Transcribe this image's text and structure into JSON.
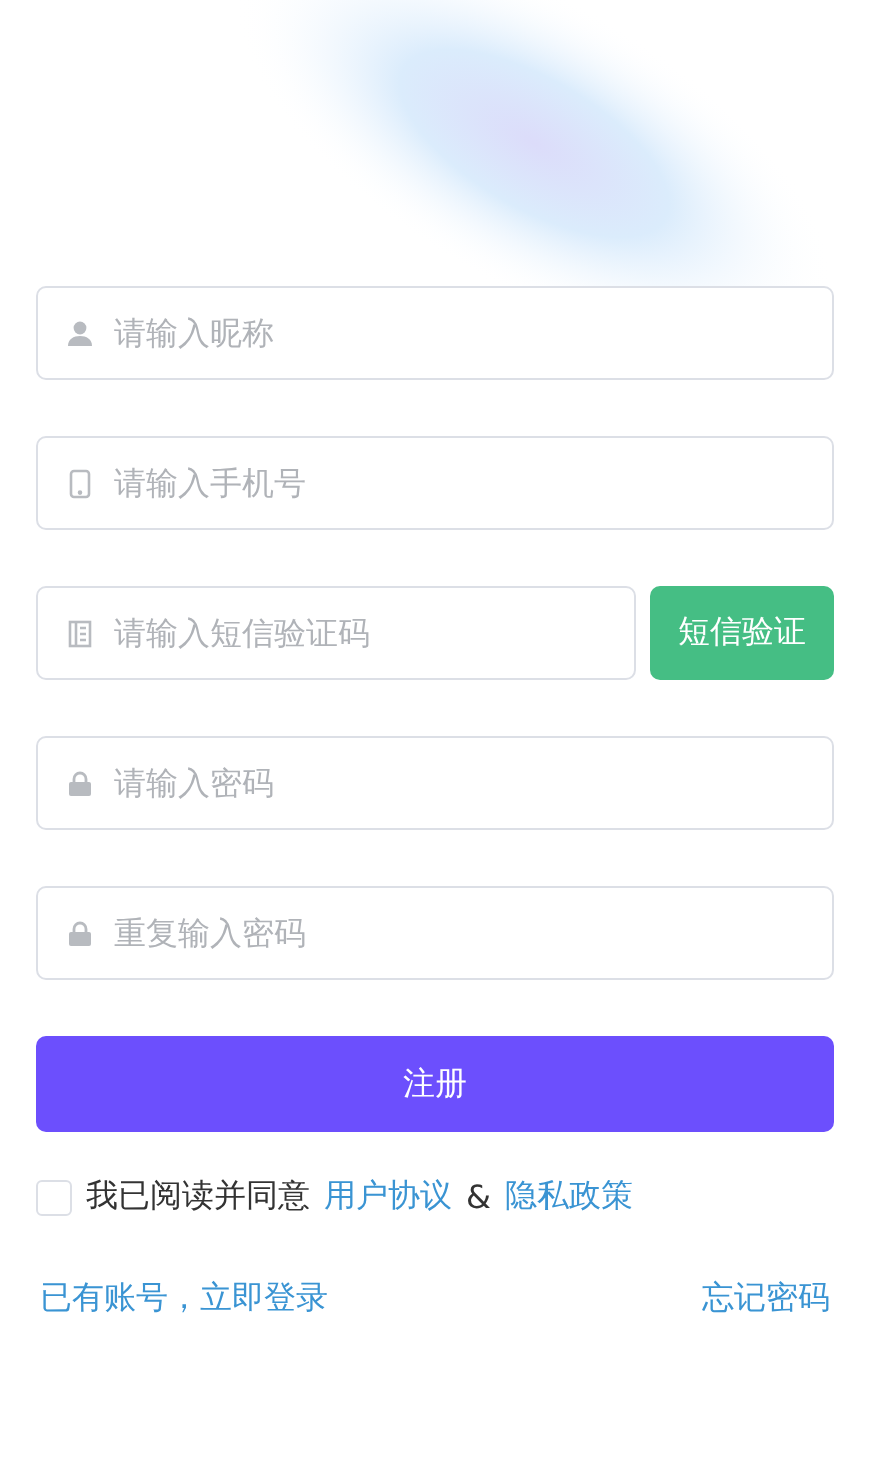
{
  "fields": [
    {
      "kind": "nickname",
      "placeholder": "请输入昵称"
    },
    {
      "kind": "phone",
      "placeholder": "请输入手机号"
    },
    {
      "kind": "code",
      "placeholder": "请输入短信验证码",
      "button": "短信验证"
    },
    {
      "kind": "password",
      "placeholder": "请输入密码"
    },
    {
      "kind": "password",
      "placeholder": "重复输入密码"
    }
  ],
  "submit": "注册",
  "agreement": {
    "checked": false,
    "text": "我已阅读并同意",
    "links": [
      "用户协议",
      "隐私政策"
    ],
    "separator": "&"
  },
  "footer": {
    "login": "已有账号，立即登录",
    "forgot": "忘记密码"
  }
}
